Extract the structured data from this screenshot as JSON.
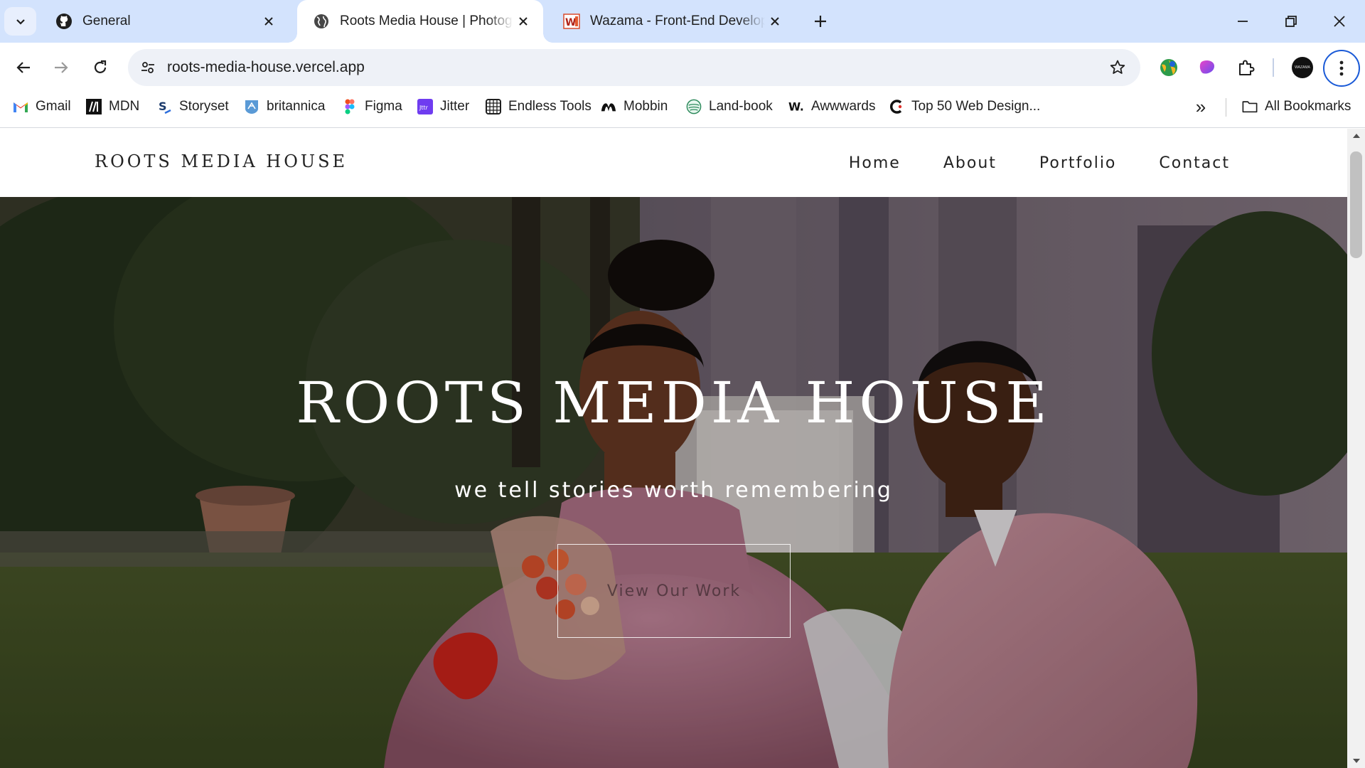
{
  "browser": {
    "tabs": [
      {
        "title": "General",
        "favicon": "github-icon",
        "active": false
      },
      {
        "title": "Roots Media House | Photography",
        "favicon": "globe-icon",
        "active": true
      },
      {
        "title": "Wazama - Front-End Developer",
        "favicon": "wazama-icon",
        "active": false
      }
    ],
    "address": "roots-media-house.vercel.app",
    "accent_color": "#1a5ad7",
    "tabstrip_color": "#d3e3fd",
    "profile_label": "WAZAMA"
  },
  "bookmarks": {
    "items": [
      {
        "label": "Gmail",
        "icon": "gmail-icon"
      },
      {
        "label": "MDN",
        "icon": "mdn-icon"
      },
      {
        "label": "Storyset",
        "icon": "storyset-icon"
      },
      {
        "label": "britannica",
        "icon": "britannica-icon"
      },
      {
        "label": "Figma",
        "icon": "figma-icon"
      },
      {
        "label": "Jitter",
        "icon": "jitter-icon"
      },
      {
        "label": "Endless Tools",
        "icon": "endless-tools-icon"
      },
      {
        "label": "Mobbin",
        "icon": "mobbin-icon"
      },
      {
        "label": "Land-book",
        "icon": "land-book-icon"
      },
      {
        "label": "Awwwards",
        "icon": "awwwards-icon"
      },
      {
        "label": "Top 50 Web Design...",
        "icon": "top50-icon"
      }
    ],
    "more_label": "»",
    "all_bookmarks_label": "All Bookmarks"
  },
  "site": {
    "logo": "ROOTS MEDIA HOUSE",
    "nav": [
      "Home",
      "About",
      "Portfolio",
      "Contact"
    ],
    "hero": {
      "title": "ROOTS MEDIA HOUSE",
      "subtitle": "we tell stories worth remembering",
      "cta_label": "View Our Work"
    }
  }
}
